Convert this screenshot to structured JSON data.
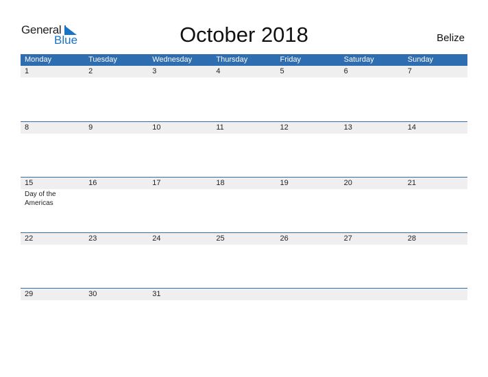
{
  "logo": {
    "part1": "General",
    "part2": "Blue"
  },
  "title": "October 2018",
  "country": "Belize",
  "weekdays": [
    "Monday",
    "Tuesday",
    "Wednesday",
    "Thursday",
    "Friday",
    "Saturday",
    "Sunday"
  ],
  "weeks": [
    [
      {
        "d": "1"
      },
      {
        "d": "2"
      },
      {
        "d": "3"
      },
      {
        "d": "4"
      },
      {
        "d": "5"
      },
      {
        "d": "6"
      },
      {
        "d": "7"
      }
    ],
    [
      {
        "d": "8"
      },
      {
        "d": "9"
      },
      {
        "d": "10"
      },
      {
        "d": "11"
      },
      {
        "d": "12"
      },
      {
        "d": "13"
      },
      {
        "d": "14"
      }
    ],
    [
      {
        "d": "15",
        "event": "Day of the Americas"
      },
      {
        "d": "16"
      },
      {
        "d": "17"
      },
      {
        "d": "18"
      },
      {
        "d": "19"
      },
      {
        "d": "20"
      },
      {
        "d": "21"
      }
    ],
    [
      {
        "d": "22"
      },
      {
        "d": "23"
      },
      {
        "d": "24"
      },
      {
        "d": "25"
      },
      {
        "d": "26"
      },
      {
        "d": "27"
      },
      {
        "d": "28"
      }
    ],
    [
      {
        "d": "29"
      },
      {
        "d": "30"
      },
      {
        "d": "31"
      },
      {
        "d": ""
      },
      {
        "d": ""
      },
      {
        "d": ""
      },
      {
        "d": ""
      }
    ]
  ],
  "colors": {
    "header": "#2e6db0",
    "date_strip": "#efefef",
    "logo_blue": "#1a73c4"
  }
}
